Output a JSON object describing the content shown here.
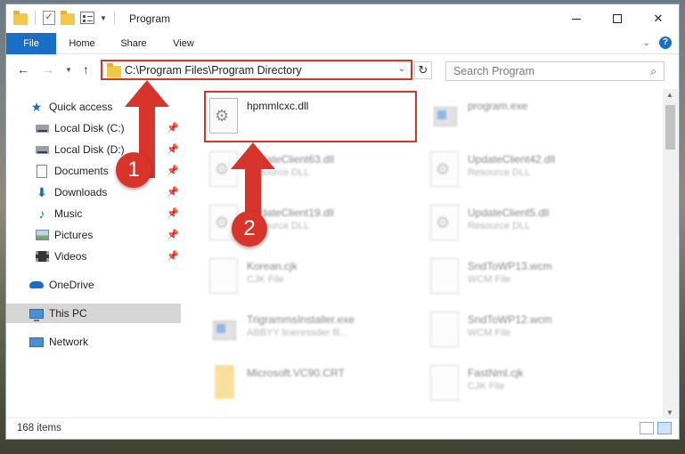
{
  "titlebar": {
    "title": "Program",
    "qat_icons": [
      "folder-icon",
      "properties-check-icon",
      "new-folder-icon",
      "customize-icon"
    ]
  },
  "ribbon": {
    "tabs": [
      {
        "label": "File"
      },
      {
        "label": "Home"
      },
      {
        "label": "Share"
      },
      {
        "label": "View"
      }
    ],
    "help": "?"
  },
  "nav": {
    "address": "C:\\Program Files\\Program Directory",
    "search_placeholder": "Search Program"
  },
  "sidebar": {
    "items": [
      {
        "label": "Quick access",
        "icon": "star-icon"
      },
      {
        "label": "Local Disk (C:)",
        "icon": "disk-icon",
        "pinned": true
      },
      {
        "label": "Local Disk (D:)",
        "icon": "disk-icon",
        "pinned": true
      },
      {
        "label": "Documents",
        "icon": "documents-icon",
        "pinned": true
      },
      {
        "label": "Downloads",
        "icon": "downloads-icon",
        "pinned": true
      },
      {
        "label": "Music",
        "icon": "music-icon",
        "pinned": true
      },
      {
        "label": "Pictures",
        "icon": "pictures-icon",
        "pinned": true
      },
      {
        "label": "Videos",
        "icon": "videos-icon",
        "pinned": true
      },
      {
        "label": "OneDrive",
        "icon": "onedrive-icon"
      },
      {
        "label": "This PC",
        "icon": "this-pc-icon",
        "selected": true
      },
      {
        "label": "Network",
        "icon": "network-icon"
      }
    ]
  },
  "files": [
    {
      "name": "hpmmlcxc.dll",
      "sub": "",
      "icon": "dll-gear-icon",
      "highlighted": true
    },
    {
      "name": "program.exe",
      "sub": "",
      "icon": "exe-icon"
    },
    {
      "name": "UpdateClient63.dll",
      "sub": "Resource DLL",
      "icon": "dll-gear-icon"
    },
    {
      "name": "UpdateClient42.dll",
      "sub": "Resource DLL",
      "icon": "dll-gear-icon"
    },
    {
      "name": "UpdateClient19.dll",
      "sub": "Resource DLL",
      "icon": "dll-gear-icon"
    },
    {
      "name": "UpdateClient5.dll",
      "sub": "Resource DLL",
      "icon": "dll-gear-icon"
    },
    {
      "name": "Korean.cjk",
      "sub": "CJK File",
      "icon": "file-icon"
    },
    {
      "name": "SndToWP13.wcm",
      "sub": "WCM File",
      "icon": "file-icon"
    },
    {
      "name": "TrigrammsInstaller.exe",
      "sub": "ABBYY lineressder fil...",
      "icon": "exe-icon"
    },
    {
      "name": "SndToWP12.wcm",
      "sub": "WCM File",
      "icon": "file-icon"
    },
    {
      "name": "Microsoft.VC90.CRT",
      "sub": "",
      "icon": "folder-icon"
    },
    {
      "name": "FastNml.cjk",
      "sub": "CJK File",
      "icon": "file-icon"
    }
  ],
  "status": {
    "item_count": "168 items"
  },
  "annotations": {
    "badge1": "1",
    "badge2": "2"
  },
  "colors": {
    "accent": "#1a6fc4",
    "annotation_red": "#d9342b"
  }
}
